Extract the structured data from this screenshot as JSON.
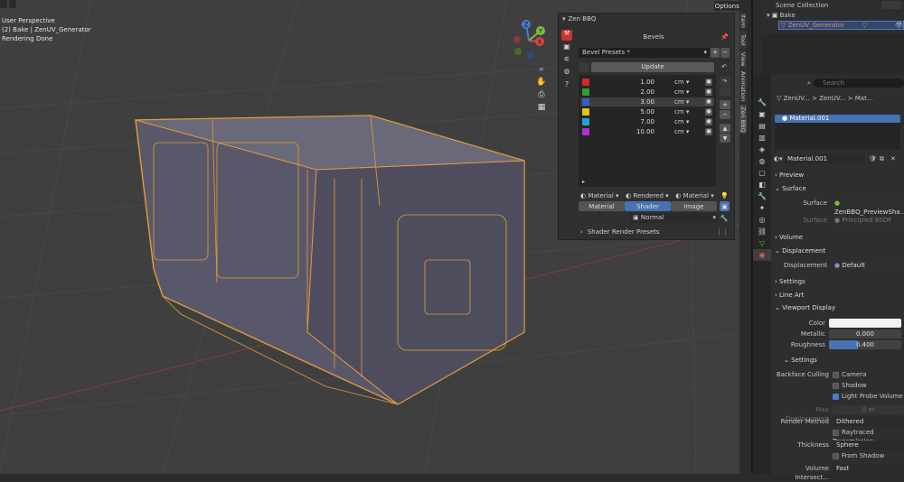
{
  "viewport": {
    "overlay": [
      "User Perspective",
      "(2) Bake | ZenUV_Generator",
      "Rendering Done"
    ],
    "options_label": "Options",
    "gizmo": {
      "x": "X",
      "y": "Y",
      "z": "Z"
    }
  },
  "zen_panel": {
    "title": "Zen BBQ",
    "bevels_header": "Bevels",
    "presets": "Bevel Presets *",
    "update": "Update",
    "bevel_rows": [
      {
        "color": "#d62828",
        "value": "1.00",
        "unit": "cm"
      },
      {
        "color": "#2aa02a",
        "value": "2.00",
        "unit": "cm"
      },
      {
        "color": "#2f5fc8",
        "value": "3.00",
        "unit": "cm"
      },
      {
        "color": "#e0c020",
        "value": "5.00",
        "unit": "cm"
      },
      {
        "color": "#1aa8d8",
        "value": "7.00",
        "unit": "cm"
      },
      {
        "color": "#b030d0",
        "value": "10.00",
        "unit": "cm"
      }
    ],
    "shading": {
      "left": "Material",
      "mid": "Rendered",
      "right": "Material"
    },
    "tabs3": [
      "Material",
      "Shader",
      "Image"
    ],
    "normal": "Normal",
    "shader_presets": "Shader Render Presets",
    "side_tabs": [
      "Item",
      "Tool",
      "View",
      "Animation",
      "Zen BBQ"
    ]
  },
  "outliner": {
    "scene_collection": "Scene Collection",
    "bake": "Bake",
    "object": "ZenUV_Generator"
  },
  "properties": {
    "search_placeholder": "Search",
    "breadcrumb": [
      "ZenUV...",
      "ZenUV...",
      "Mat..."
    ],
    "material_slot": "Material.001",
    "material_name": "Material.001",
    "preview": "Preview",
    "surface_header": "Surface",
    "surface_label": "Surface",
    "surface_value": "ZenBBQ_PreviewSha...",
    "principled_label": "Surface",
    "principled_value": "Principled BSDF",
    "volume": "Volume",
    "displacement_header": "Displacement",
    "displacement_label": "Displacement",
    "displacement_value": "Default",
    "settings": "Settings",
    "line_art": "Line Art",
    "viewport_display": "Viewport Display",
    "color_label": "Color",
    "metallic_label": "Metallic",
    "metallic_value": "0.000",
    "roughness_label": "Roughness",
    "roughness_value": "0.400",
    "roughness_fraction": 0.4,
    "settings2": "Settings",
    "backface_label": "Backface Culling",
    "camera": "Camera",
    "shadow": "Shadow",
    "light_probe": "Light Probe Volume",
    "max_disp_label": "Max Displacement",
    "max_disp_value": "0 m",
    "render_method_label": "Render Method",
    "render_method_value": "Dithered",
    "raytraced": "Raytraced Transmission",
    "thickness_label": "Thickness",
    "thickness_value": "Sphere",
    "from_shadow": "From Shadow",
    "volume_intersect_label": "Volume Intersect...",
    "volume_intersect_value": "Fast"
  }
}
